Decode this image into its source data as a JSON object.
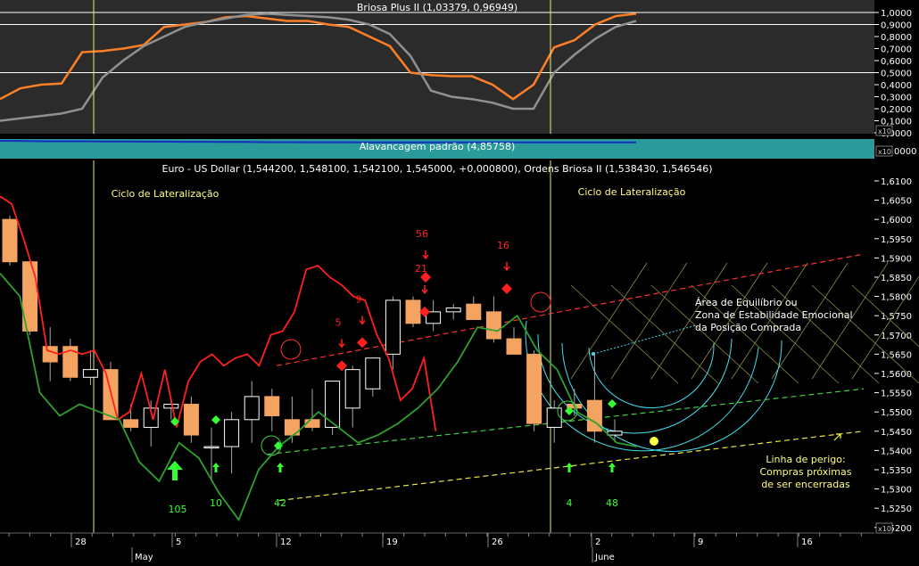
{
  "panels": {
    "oscillator_title": "Briosa Plus II (1,03379, 0,96949)",
    "leverage_title": "Alavancagem padrão (4,85758)",
    "leverage_badge": "x10",
    "leverage_axis_label": "0000",
    "main_title": "Euro - US Dollar (1,544200, 1,548100, 1,542100, 1,545000, +0,000800), Ordens Briosa II (1,538430, 1,546546)",
    "date_axis_badge": "x10",
    "oscillator_badge": "x10"
  },
  "annotations": {
    "cycle_left": "Ciclo de Lateralização",
    "cycle_right": "Ciclo de Lateralização",
    "equilibrium_line1": "Área de Equilíbrio ou",
    "equilibrium_line2": "Zona de Estabilidade Emocional",
    "equilibrium_line3": "da Posição Comprada",
    "danger_line1": "Linha de perigo:",
    "danger_line2": "Compras próximas",
    "danger_line3": "de ser encerradas",
    "sell_counts": [
      "5",
      "9",
      "21",
      "56",
      "16"
    ],
    "buy_counts": [
      "105",
      "10",
      "42",
      "4",
      "48"
    ]
  },
  "colors": {
    "background": "#000000",
    "up_candle": "#ffffff",
    "down_candle": "#f4a460",
    "red_line": "#ff2020",
    "green_line": "#2ea02e",
    "osc_fast": "#ff7f27",
    "osc_slow": "#909090",
    "leverage_band": "#2a9a9a",
    "cursor": "#e8e87a",
    "sell_marker": "#ff2020",
    "buy_marker": "#33ff33",
    "annotation_text": "#ffff80"
  },
  "chart_data": [
    {
      "type": "line",
      "title": "Briosa Plus II (1,03379, 0,96949)",
      "y_ticks": [
        "1,0000",
        "0,9000",
        "0,8000",
        "0,7000",
        "0,6000",
        "0,5000",
        "0,4000",
        "0,3000",
        "0,2000",
        "0,1000",
        "0,0000"
      ],
      "ylim": [
        0,
        1.0
      ],
      "reference_levels": [
        1.0,
        0.9,
        0.5
      ],
      "series": [
        {
          "values": [
            0.28,
            0.37,
            0.4,
            0.41,
            0.67,
            0.68,
            0.7,
            0.73,
            0.88,
            0.9,
            0.92,
            0.96,
            0.97,
            0.95,
            0.93,
            0.93,
            0.9,
            0.88,
            0.8,
            0.72,
            0.5,
            0.48,
            0.47,
            0.47,
            0.4,
            0.28,
            0.4,
            0.71,
            0.77,
            0.9,
            0.97,
            0.99
          ]
        },
        {
          "values": [
            0.1,
            0.12,
            0.14,
            0.16,
            0.2,
            0.46,
            0.6,
            0.72,
            0.8,
            0.88,
            0.92,
            0.95,
            0.98,
            0.99,
            0.98,
            0.97,
            0.96,
            0.94,
            0.9,
            0.82,
            0.64,
            0.35,
            0.3,
            0.28,
            0.25,
            0.2,
            0.2,
            0.5,
            0.65,
            0.78,
            0.88,
            0.93
          ]
        }
      ]
    },
    {
      "type": "line",
      "title": "Alavancagem padrão (4,85758)",
      "series": [
        {
          "values": [
            4.96,
            4.95,
            4.93,
            4.93,
            4.93,
            4.92,
            4.92,
            4.91,
            4.91,
            4.9,
            4.9,
            4.89,
            4.89,
            4.88,
            4.88,
            4.87,
            4.87,
            4.87,
            4.86,
            4.86,
            4.86,
            4.86,
            4.86,
            4.86,
            4.86,
            4.86,
            4.86,
            4.86,
            4.86,
            4.86,
            4.86,
            4.86
          ]
        }
      ]
    },
    {
      "type": "candlestick",
      "title": "Euro - US Dollar (1,544200, 1,548100, 1,542100, 1,545000, +0,000800), Ordens Briosa II (1,538430, 1,546546)",
      "y_ticks": [
        "1,6100",
        "1,6050",
        "1,6000",
        "1,5950",
        "1,5900",
        "1,5850",
        "1,5800",
        "1,5750",
        "1,5700",
        "1,5650",
        "1,5600",
        "1,5550",
        "1,5500",
        "1,5450",
        "1,5400",
        "1,5350",
        "1,5300",
        "1,5250",
        "1,5200"
      ],
      "ylim": [
        1.517,
        1.613
      ],
      "x_ticks": [
        "28",
        "5",
        "12",
        "19",
        "26",
        "2",
        "9",
        "16"
      ],
      "month_labels": [
        "May",
        "June"
      ],
      "candles": [
        {
          "o": 1.6,
          "h": 1.601,
          "l": 1.588,
          "c": 1.589
        },
        {
          "o": 1.589,
          "h": 1.59,
          "l": 1.57,
          "c": 1.571
        },
        {
          "o": 1.567,
          "h": 1.572,
          "l": 1.558,
          "c": 1.563
        },
        {
          "o": 1.567,
          "h": 1.569,
          "l": 1.558,
          "c": 1.559
        },
        {
          "o": 1.559,
          "h": 1.566,
          "l": 1.557,
          "c": 1.561
        },
        {
          "o": 1.561,
          "h": 1.563,
          "l": 1.548,
          "c": 1.548
        },
        {
          "o": 1.548,
          "h": 1.552,
          "l": 1.545,
          "c": 1.546
        },
        {
          "o": 1.546,
          "h": 1.553,
          "l": 1.541,
          "c": 1.551
        },
        {
          "o": 1.551,
          "h": 1.553,
          "l": 1.548,
          "c": 1.552
        },
        {
          "o": 1.552,
          "h": 1.554,
          "l": 1.542,
          "c": 1.544
        },
        {
          "o": 1.541,
          "h": 1.546,
          "l": 1.532,
          "c": 1.541
        },
        {
          "o": 1.541,
          "h": 1.55,
          "l": 1.534,
          "c": 1.548
        },
        {
          "o": 1.548,
          "h": 1.558,
          "l": 1.542,
          "c": 1.554
        },
        {
          "o": 1.554,
          "h": 1.556,
          "l": 1.545,
          "c": 1.549
        },
        {
          "o": 1.548,
          "h": 1.554,
          "l": 1.542,
          "c": 1.544
        },
        {
          "o": 1.548,
          "h": 1.556,
          "l": 1.545,
          "c": 1.546
        },
        {
          "o": 1.546,
          "h": 1.558,
          "l": 1.544,
          "c": 1.558
        },
        {
          "o": 1.551,
          "h": 1.562,
          "l": 1.546,
          "c": 1.561
        },
        {
          "o": 1.556,
          "h": 1.564,
          "l": 1.554,
          "c": 1.564
        },
        {
          "o": 1.565,
          "h": 1.58,
          "l": 1.561,
          "c": 1.579
        },
        {
          "o": 1.579,
          "h": 1.58,
          "l": 1.572,
          "c": 1.573
        },
        {
          "o": 1.573,
          "h": 1.579,
          "l": 1.571,
          "c": 1.576
        },
        {
          "o": 1.576,
          "h": 1.578,
          "l": 1.574,
          "c": 1.577
        },
        {
          "o": 1.578,
          "h": 1.58,
          "l": 1.574,
          "c": 1.574
        },
        {
          "o": 1.576,
          "h": 1.58,
          "l": 1.568,
          "c": 1.569
        },
        {
          "o": 1.569,
          "h": 1.572,
          "l": 1.565,
          "c": 1.565
        },
        {
          "o": 1.565,
          "h": 1.566,
          "l": 1.545,
          "c": 1.547
        },
        {
          "o": 1.546,
          "h": 1.553,
          "l": 1.542,
          "c": 1.551
        },
        {
          "o": 1.552,
          "h": 1.556,
          "l": 1.549,
          "c": 1.551
        },
        {
          "o": 1.553,
          "h": 1.565,
          "l": 1.542,
          "c": 1.545
        },
        {
          "o": 1.544,
          "h": 1.5481,
          "l": 1.5421,
          "c": 1.545
        }
      ],
      "red_line": [
        1.606,
        1.604,
        1.595,
        1.585,
        1.566,
        1.565,
        1.566,
        1.565,
        1.566,
        1.56,
        1.548,
        1.55,
        1.56,
        1.548,
        1.561,
        1.546,
        1.558,
        1.563,
        1.565,
        1.562,
        1.564,
        1.565,
        1.562,
        1.57,
        1.571,
        1.576,
        1.587,
        1.588,
        1.585,
        1.583,
        1.58,
        1.579,
        1.57,
        1.564,
        1.553,
        1.556,
        1.564,
        1.545
      ],
      "green_line": [
        1.586,
        1.58,
        1.555,
        1.549,
        1.552,
        1.55,
        1.548,
        1.537,
        1.532,
        1.542,
        1.538,
        1.529,
        1.522,
        1.535,
        1.541,
        1.545,
        1.55,
        1.546,
        1.542,
        1.544,
        1.547,
        1.551,
        1.556,
        1.563,
        1.572,
        1.571,
        1.575,
        1.566,
        1.561,
        1.55,
        1.547,
        1.542,
        1.541
      ],
      "sell_signals": [
        1.562,
        1.568,
        1.576,
        1.585,
        1.582
      ],
      "buy_signals": [
        1.536,
        1.538,
        1.531,
        1.538,
        1.538
      ],
      "trend_lines": [
        {
          "color": "red",
          "from": 1.562,
          "to": 1.591
        },
        {
          "color": "green",
          "from": 1.539,
          "to": 1.556
        },
        {
          "color": "yellow",
          "from": 1.527,
          "to": 1.545
        }
      ]
    }
  ]
}
